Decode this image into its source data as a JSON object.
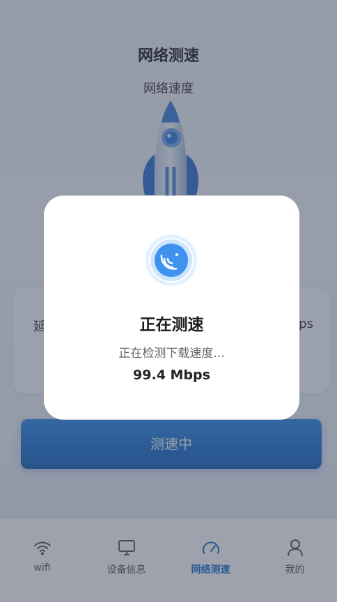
{
  "header": {
    "title": "网络测速",
    "subtitle": "网络速度"
  },
  "stats": {
    "left_label_fragment": "延",
    "right_label_fragment": "ops"
  },
  "action": {
    "button_label": "测速中"
  },
  "tabs": [
    {
      "label": "wifi",
      "icon": "wifi-icon",
      "active": false
    },
    {
      "label": "设备信息",
      "icon": "monitor-icon",
      "active": false
    },
    {
      "label": "网络测速",
      "icon": "speedometer-icon",
      "active": true
    },
    {
      "label": "我的",
      "icon": "user-icon",
      "active": false
    }
  ],
  "dialog": {
    "title": "正在测速",
    "status": "正在检测下载速度...",
    "speed": "99.4 Mbps",
    "icon": "signal-icon"
  },
  "colors": {
    "accent": "#1a6fd0",
    "button_gradient_top": "#2d8ae8",
    "modal_bg": "#ffffff"
  }
}
